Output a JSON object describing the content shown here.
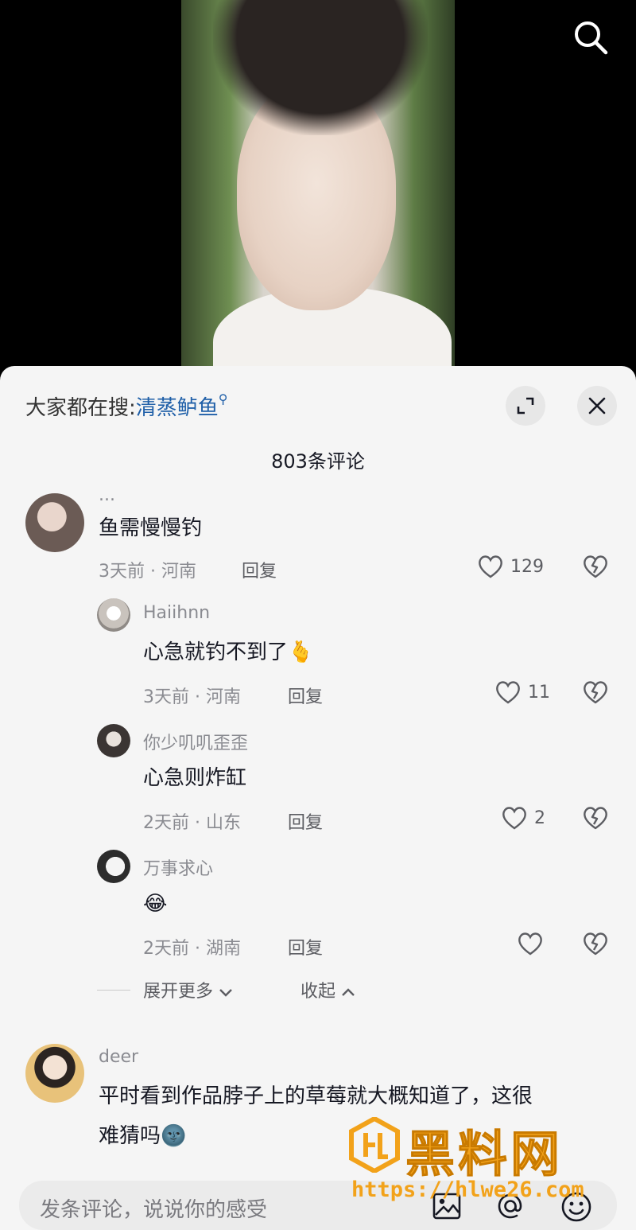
{
  "trend": {
    "prefix": "大家都在搜:",
    "keyword": "清蒸鲈鱼"
  },
  "comment_count_label": "803条评论",
  "comments": [
    {
      "username": "...",
      "text": "鱼需慢慢钓",
      "meta": "3天前 · 河南",
      "reply_label": "回复",
      "likes": "129",
      "avatar_color": "#6b5b55"
    },
    {
      "username": "Haiihnn",
      "text": "心急就钓不到了",
      "emoji": "🫰",
      "meta": "3天前 · 河南",
      "reply_label": "回复",
      "likes": "11",
      "avatar_color": "#c9c3bd"
    },
    {
      "username": "你少叽叽歪歪",
      "text": "心急则炸缸",
      "meta": "2天前 · 山东",
      "reply_label": "回复",
      "likes": "2",
      "avatar_color": "#3b3533"
    },
    {
      "username": "万事求心",
      "emoji": "😂",
      "meta": "2天前 · 湖南",
      "reply_label": "回复",
      "likes": "",
      "avatar_color": "#e6e6e6"
    },
    {
      "username": "deer",
      "text_line1": "平时看到作品脖子上的草莓就大概知道了，这很",
      "text_line2": "难猜吗",
      "emoji": "🌚",
      "avatar_color": "#e8c27a"
    }
  ],
  "thread": {
    "expand_more": "展开更多",
    "collapse": "收起"
  },
  "input": {
    "placeholder": "发条评论，说说你的感受"
  },
  "watermark": {
    "title": "黑料网",
    "url": "https://hlwe26.com"
  },
  "icons": {
    "search": "search-icon",
    "expand": "expand-icon",
    "close": "close-icon",
    "like": "heart-icon",
    "dislike": "broken-heart-icon",
    "image": "image-icon",
    "mention": "at-icon",
    "emoji": "smiley-icon"
  },
  "colors": {
    "keyword": "#1f5fa8",
    "sheet_bg": "#f5f5f5",
    "watermark": "#f2a21a"
  }
}
